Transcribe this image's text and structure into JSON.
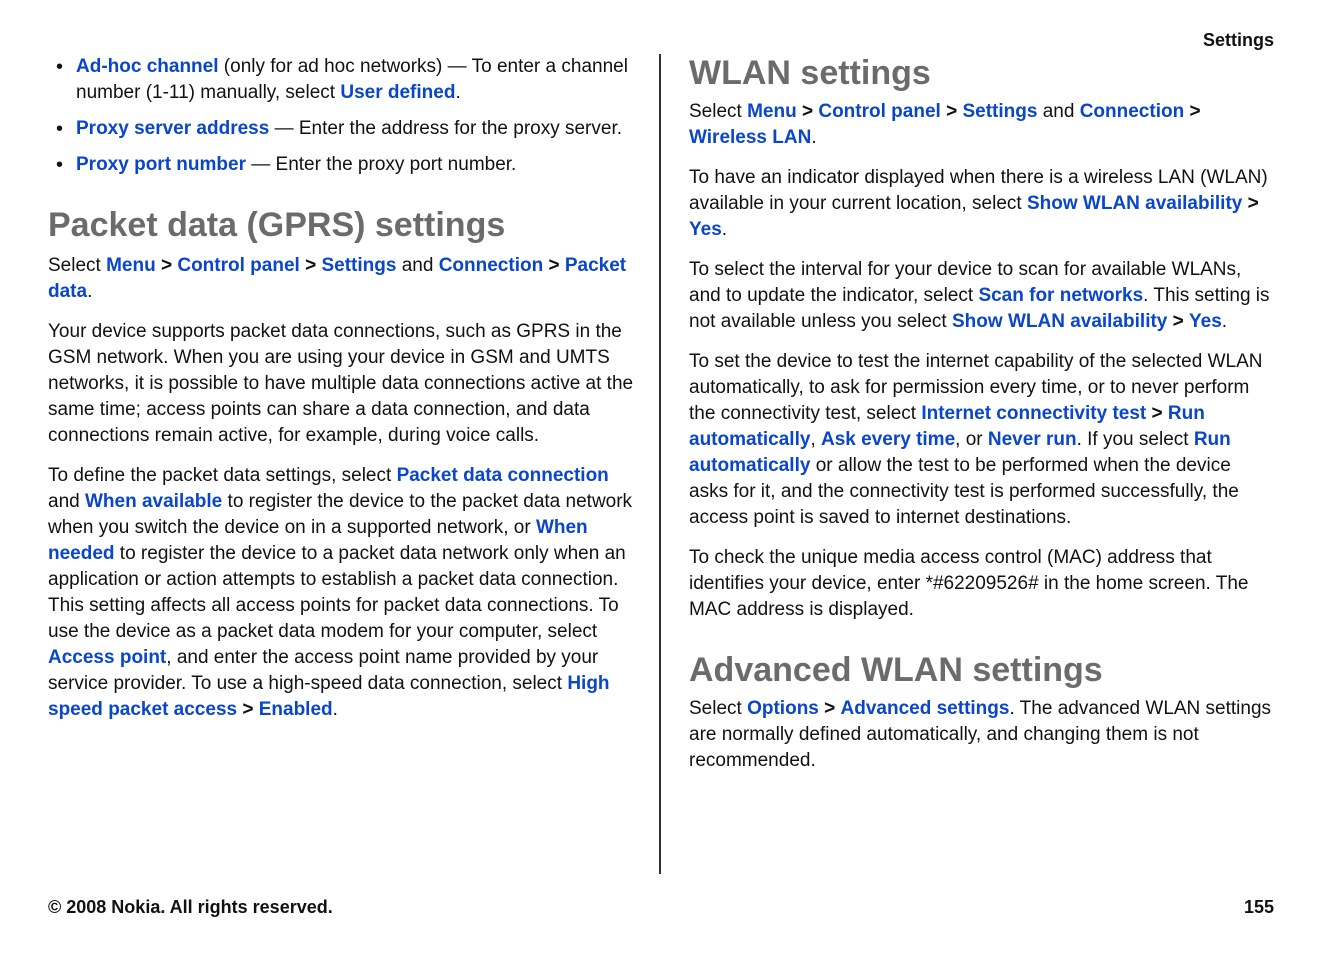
{
  "header": {
    "section_label": "Settings"
  },
  "left": {
    "bullets": [
      {
        "term": "Ad-hoc channel",
        "desc_before": " (only for ad hoc networks)  — To enter a channel number (1-11) manually, select ",
        "action": "User defined",
        "desc_after": "."
      },
      {
        "term": "Proxy server address",
        "desc_before": "  — Enter the address for the proxy server.",
        "action": "",
        "desc_after": ""
      },
      {
        "term": "Proxy port number",
        "desc_before": "  — Enter the proxy port number.",
        "action": "",
        "desc_after": ""
      }
    ],
    "h_packet": "Packet data (GPRS) settings",
    "packet_nav": {
      "pre": "Select ",
      "menu": "Menu",
      "cp": "Control panel",
      "settings": "Settings",
      "and": " and ",
      "connection": "Connection",
      "packet": "Packet data",
      "dot": "."
    },
    "packet_p1": "Your device supports packet data connections, such as GPRS in the GSM network. When you are using your device in GSM and UMTS networks, it is possible to have multiple data connections active at the same time; access points can share a data connection, and data connections remain active, for example, during voice calls.",
    "packet_p2_a": "To define the packet data settings, select ",
    "packet_p2_link1": "Packet data connection",
    "packet_p2_b": " and ",
    "packet_p2_link2": "When available",
    "packet_p2_c": " to register the device to the packet data network when you switch the device on in a supported network, or ",
    "packet_p2_link3": "When needed",
    "packet_p2_d": " to register the device to a packet data network only when an application or action attempts to establish a packet data connection. This setting affects all access points for packet data connections. To use the device as a packet data modem for your computer, select ",
    "packet_p2_link4": "Access point",
    "packet_p2_e": ", and enter the access point name provided by your service provider. To use a high-speed data connection, select ",
    "packet_p2_link5": "High speed packet access",
    "packet_p2_f": "  >  ",
    "packet_p2_link6": "Enabled",
    "packet_p2_g": "."
  },
  "right": {
    "h_wlan": "WLAN settings",
    "wlan_nav": {
      "pre": "Select ",
      "menu": "Menu",
      "cp": "Control panel",
      "settings": "Settings",
      "and": " and ",
      "connection": "Connection",
      "wlan": "Wireless LAN",
      "dot": "."
    },
    "wlan_p1_a": "To have an indicator displayed when there is a wireless LAN (WLAN) available in your current location, select ",
    "wlan_p1_link1": "Show WLAN availability",
    "wlan_p1_sep": "  >  ",
    "wlan_p1_link2": "Yes",
    "wlan_p1_b": ".",
    "wlan_p2_a": "To select the interval for your device to scan for available WLANs, and to update the indicator, select ",
    "wlan_p2_link1": "Scan for networks",
    "wlan_p2_b": ". This setting is not available unless you select ",
    "wlan_p2_link2": "Show WLAN availability",
    "wlan_p2_sep": "  >  ",
    "wlan_p2_link3": "Yes",
    "wlan_p2_c": ".",
    "wlan_p3_a": "To set the device to test the internet capability of the selected WLAN automatically, to ask for permission every time, or to never perform the connectivity test, select ",
    "wlan_p3_link1": "Internet connectivity test",
    "wlan_p3_sep": "  >  ",
    "wlan_p3_link2": "Run automatically",
    "wlan_p3_comma": ", ",
    "wlan_p3_link3": "Ask every time",
    "wlan_p3_or": ", or ",
    "wlan_p3_link4": "Never run",
    "wlan_p3_b": ". If you select ",
    "wlan_p3_link5": "Run automatically",
    "wlan_p3_c": " or allow the test to be performed when the device asks for it, and the connectivity test is performed successfully, the access point is saved to internet destinations.",
    "wlan_p4": "To check the unique media access control (MAC) address that identifies your device, enter *#62209526# in the home screen. The MAC address is displayed.",
    "h_advanced": "Advanced WLAN settings",
    "adv_a": "Select ",
    "adv_link1": "Options",
    "adv_sep": "  >  ",
    "adv_link2": "Advanced settings",
    "adv_b": ". The advanced WLAN settings are normally defined automatically, and changing them is not recommended."
  },
  "footer": {
    "copyright": "© 2008 Nokia. All rights reserved.",
    "page": "155"
  },
  "sep": " > "
}
